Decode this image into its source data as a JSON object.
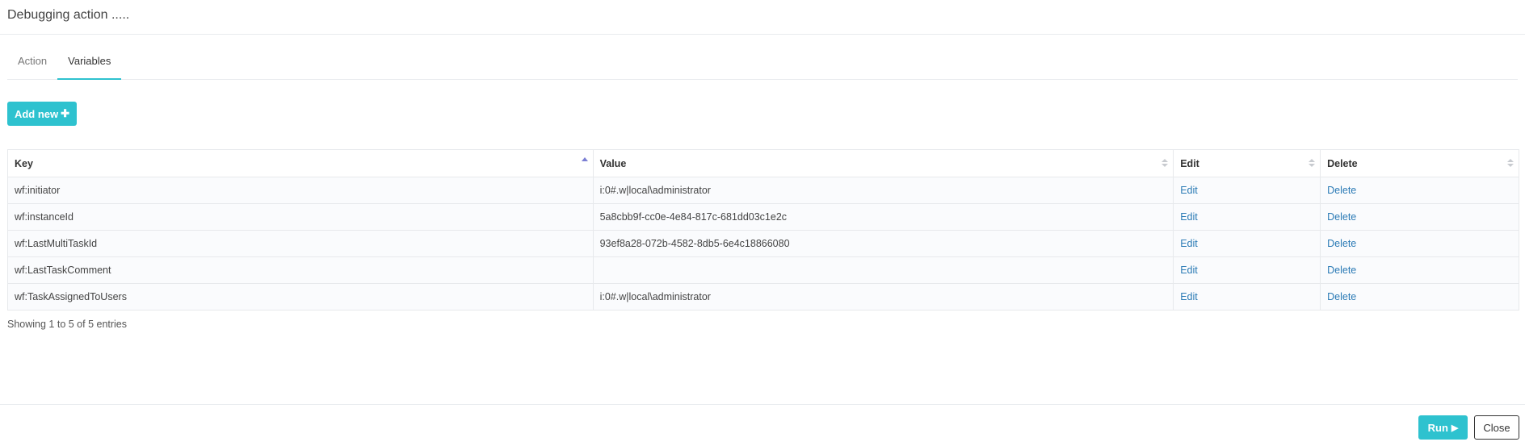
{
  "dialog": {
    "title": "Debugging action ....."
  },
  "tabs": [
    {
      "label": "Action",
      "active": false
    },
    {
      "label": "Variables",
      "active": true
    }
  ],
  "toolbar": {
    "add_label": "Add new",
    "add_icon": "plus-icon"
  },
  "table": {
    "columns": [
      {
        "label": "Key",
        "sort": "ascending"
      },
      {
        "label": "Value",
        "sort": "none"
      },
      {
        "label": "Edit",
        "sort": "none"
      },
      {
        "label": "Delete",
        "sort": "none"
      }
    ],
    "rows": [
      {
        "key": "wf:initiator",
        "value": "i:0#.w|local\\administrator",
        "edit": "Edit",
        "delete": "Delete"
      },
      {
        "key": "wf:instanceId",
        "value": "5a8cbb9f-cc0e-4e84-817c-681dd03c1e2c",
        "edit": "Edit",
        "delete": "Delete"
      },
      {
        "key": "wf:LastMultiTaskId",
        "value": "93ef8a28-072b-4582-8db5-6e4c18866080",
        "edit": "Edit",
        "delete": "Delete"
      },
      {
        "key": "wf:LastTaskComment",
        "value": "",
        "edit": "Edit",
        "delete": "Delete"
      },
      {
        "key": "wf:TaskAssignedToUsers",
        "value": "i:0#.w|local\\administrator",
        "edit": "Edit",
        "delete": "Delete"
      }
    ],
    "info": "Showing 1 to 5 of 5 entries"
  },
  "footer": {
    "run_label": "Run",
    "run_icon": "play-icon",
    "close_label": "Close"
  },
  "colors": {
    "accent": "#2ec2cf",
    "link": "#2a7ab5",
    "sort_active": "#7b7fd4",
    "sort_inactive": "#c8cbd0"
  }
}
